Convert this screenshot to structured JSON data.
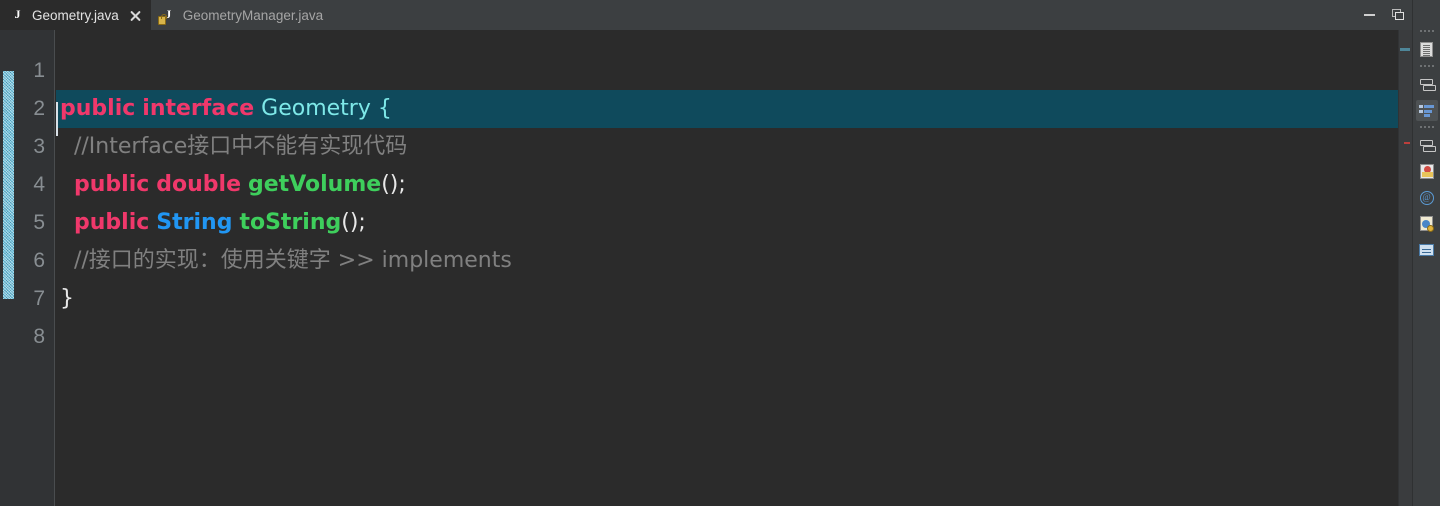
{
  "window": {
    "controls": [
      {
        "name": "minimize",
        "label": "Minimize"
      },
      {
        "name": "restore",
        "label": "Restore Down"
      }
    ]
  },
  "tabs": [
    {
      "label": "Geometry.java",
      "icon": "java-file-icon",
      "active": true,
      "closable": true,
      "close_label": "Close tab"
    },
    {
      "label": "GeometryManager.java",
      "icon": "java-file-locked-icon",
      "active": false,
      "closable": false
    }
  ],
  "editor": {
    "file": "Geometry.java",
    "language": "Java",
    "line_numbers": [
      "1",
      "2",
      "3",
      "4",
      "5",
      "6",
      "7",
      "8"
    ],
    "caret_line": 2,
    "highlight_line": 2,
    "vcs_change_marker": {
      "from_line": 2,
      "to_line": 7,
      "color": "#5fc3e4"
    },
    "colors": {
      "background": "#2b2b2b",
      "gutter": "#313335",
      "current_line_highlight": "#0f4a5c",
      "keyword": "#f0386b",
      "class_name": "#7ee8e8",
      "type": "#2196f3",
      "method": "#3ecf5c",
      "comment": "#808080",
      "punctuation": "#e8e8e8",
      "line_number": "#888e92"
    },
    "lines": [
      {
        "n": 1,
        "tokens": []
      },
      {
        "n": 2,
        "tokens": [
          {
            "t": "public",
            "c": "kw"
          },
          {
            "t": " ",
            "c": "punct"
          },
          {
            "t": "interface",
            "c": "kw"
          },
          {
            "t": " ",
            "c": "punct"
          },
          {
            "t": "Geometry",
            "c": "cls"
          },
          {
            "t": " {",
            "c": "cls"
          }
        ]
      },
      {
        "n": 3,
        "tokens": [
          {
            "t": "  //Interface接口中不能有实现代码",
            "c": "cmt"
          }
        ]
      },
      {
        "n": 4,
        "tokens": [
          {
            "t": "  ",
            "c": "punct"
          },
          {
            "t": "public",
            "c": "kw"
          },
          {
            "t": " ",
            "c": "punct"
          },
          {
            "t": "double",
            "c": "kw"
          },
          {
            "t": " ",
            "c": "punct"
          },
          {
            "t": "getVolume",
            "c": "meth"
          },
          {
            "t": "();",
            "c": "punct"
          }
        ]
      },
      {
        "n": 5,
        "tokens": [
          {
            "t": "  ",
            "c": "punct"
          },
          {
            "t": "public",
            "c": "kw"
          },
          {
            "t": " ",
            "c": "punct"
          },
          {
            "t": "String",
            "c": "type"
          },
          {
            "t": " ",
            "c": "punct"
          },
          {
            "t": "toString",
            "c": "meth"
          },
          {
            "t": "();",
            "c": "punct"
          }
        ]
      },
      {
        "n": 6,
        "tokens": [
          {
            "t": "  //接口的实现：使用关键字 >> implements",
            "c": "cmt"
          }
        ]
      },
      {
        "n": 7,
        "tokens": [
          {
            "t": "}",
            "c": "punct"
          }
        ]
      },
      {
        "n": 8,
        "tokens": []
      }
    ]
  },
  "right_rail": {
    "items": [
      {
        "name": "documentation-tool",
        "label": "Documentation",
        "glyph": "doc",
        "selected": false
      },
      {
        "name": "reformat-tool",
        "label": "Reformat",
        "glyph": "arrows",
        "selected": false
      },
      {
        "name": "structure-tool",
        "label": "Structure",
        "glyph": "struct",
        "selected": true
      },
      {
        "name": "refactor-tool",
        "label": "Refactor",
        "glyph": "arrows",
        "selected": false
      },
      {
        "name": "bookmarks-tool",
        "label": "Bookmarks",
        "glyph": "bookmark",
        "selected": false
      },
      {
        "name": "annotations-tool",
        "label": "Annotations",
        "glyph": "at",
        "selected": false
      },
      {
        "name": "file-info-tool",
        "label": "File Info",
        "glyph": "doc2",
        "selected": false
      },
      {
        "name": "terminal-tool",
        "label": "Terminal",
        "glyph": "panel",
        "selected": false
      }
    ]
  }
}
